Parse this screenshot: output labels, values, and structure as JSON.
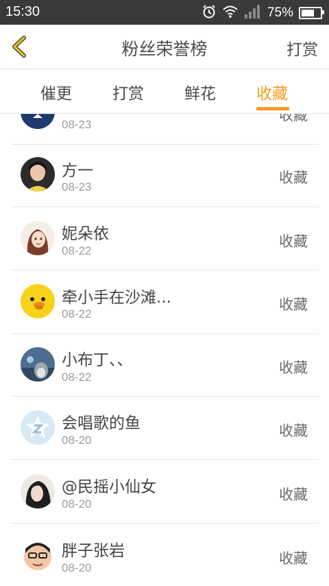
{
  "status_bar": {
    "time": "15:30",
    "battery_percent": "75%",
    "battery_level": 0.75
  },
  "header": {
    "title": "粉丝荣誉榜",
    "right_action": "打赏"
  },
  "tabs": [
    {
      "label": "催更",
      "active": false
    },
    {
      "label": "打赏",
      "active": false
    },
    {
      "label": "鲜花",
      "active": false
    },
    {
      "label": "收藏",
      "active": true
    }
  ],
  "list": [
    {
      "name": "",
      "date": "08-23",
      "action": "收藏"
    },
    {
      "name": "方一",
      "date": "08-23",
      "action": "收藏"
    },
    {
      "name": "妮朵依",
      "date": "08-22",
      "action": "收藏"
    },
    {
      "name": "牵小手在沙滩...",
      "date": "08-22",
      "action": "收藏"
    },
    {
      "name": "小布丁、、",
      "date": "08-22",
      "action": "收藏"
    },
    {
      "name": "会唱歌的鱼",
      "date": "08-20",
      "action": "收藏"
    },
    {
      "name": "@民摇小仙女",
      "date": "08-20",
      "action": "收藏"
    },
    {
      "name": "胖子张岩",
      "date": "08-20",
      "action": "收藏"
    }
  ],
  "colors": {
    "accent": "#f29c1f",
    "status_bar": "#3a3a3a",
    "text": "#4a4a4a",
    "muted": "#9b9b9b"
  }
}
